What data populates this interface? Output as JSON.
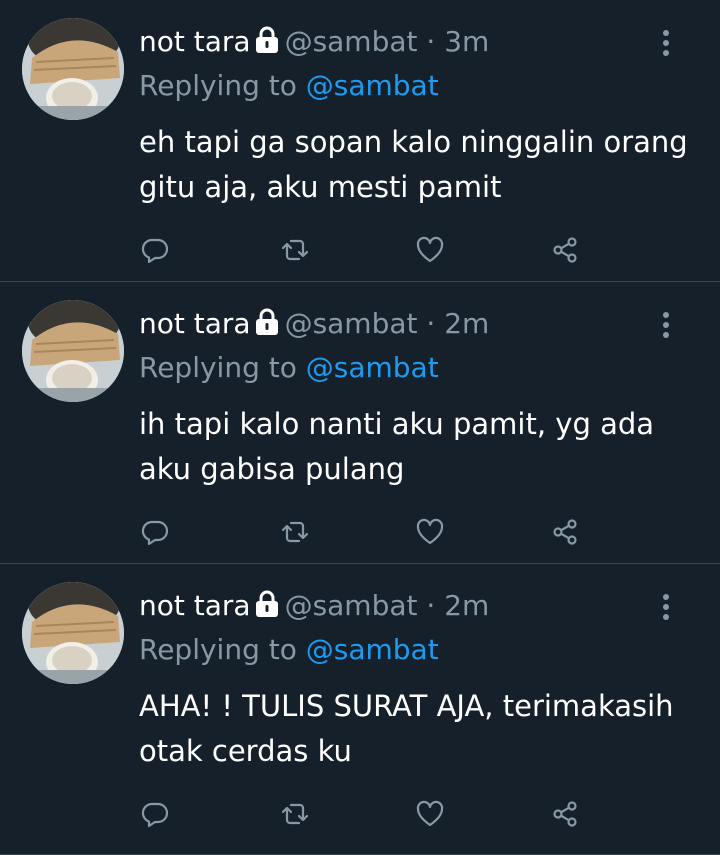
{
  "tweets": [
    {
      "name": "not tara",
      "handle": "@sambat",
      "separator": "·",
      "time": "3m",
      "replying_label": "Replying to",
      "replying_to": "@sambat",
      "text": "eh tapi ga sopan kalo ninggalin orang gitu aja, aku mesti pamit"
    },
    {
      "name": "not tara",
      "handle": "@sambat",
      "separator": "·",
      "time": "2m",
      "replying_label": "Replying to",
      "replying_to": "@sambat",
      "text": "ih tapi kalo nanti aku pamit, yg ada aku gabisa pulang"
    },
    {
      "name": "not tara",
      "handle": "@sambat",
      "separator": "·",
      "time": "2m",
      "replying_label": "Replying to",
      "replying_to": "@sambat",
      "text": "AHA! ! TULIS SURAT AJA, terimakasih otak cerdas ku"
    }
  ],
  "icons": {
    "lock": "lock-icon",
    "more": "more-vertical-icon",
    "reply": "reply-icon",
    "retweet": "retweet-icon",
    "like": "heart-icon",
    "share": "share-icon"
  },
  "colors": {
    "background": "#15202b",
    "divider": "#38444d",
    "secondary_text": "#8899a6",
    "mention": "#1d9bf0"
  }
}
